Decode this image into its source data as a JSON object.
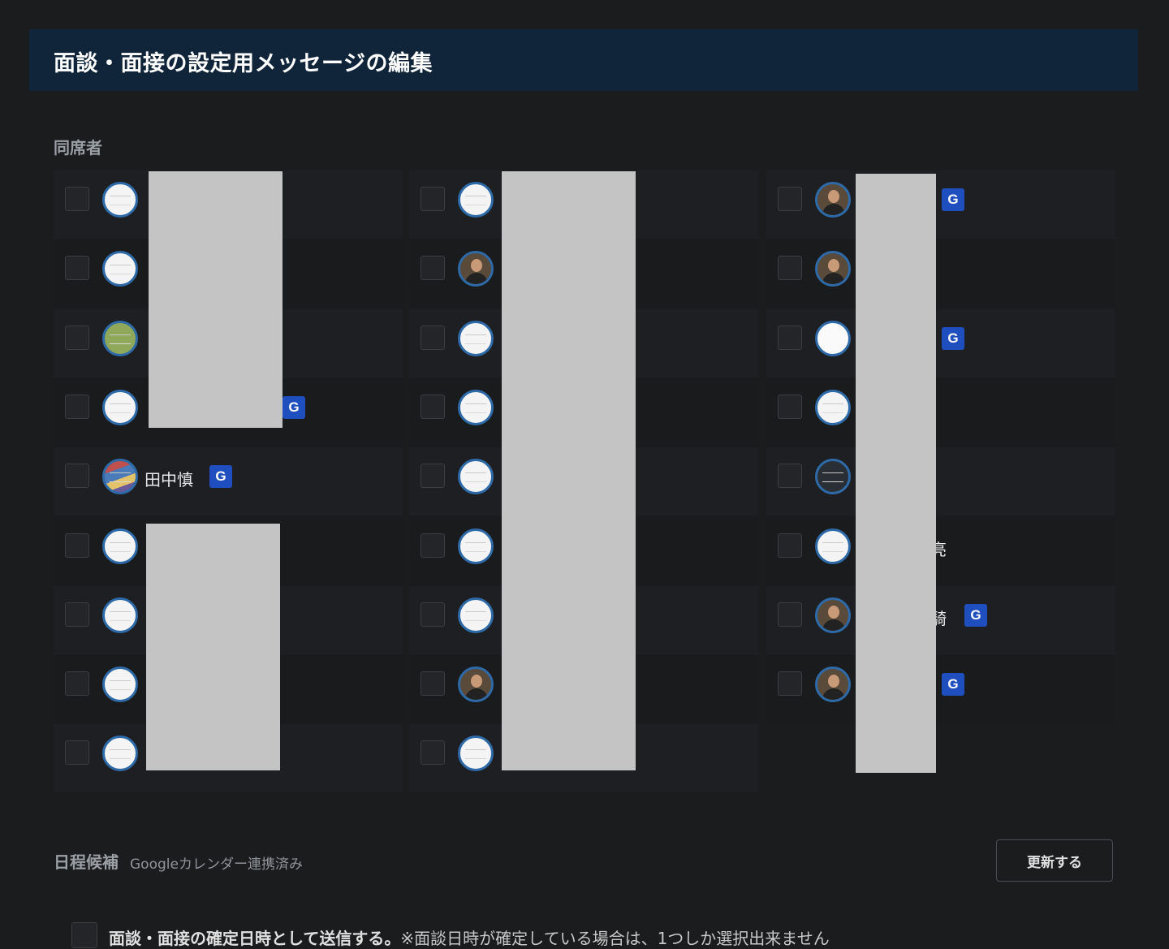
{
  "header": {
    "title": "面談・面接の設定用メッセージの編集"
  },
  "attendees_section": {
    "label": "同席者",
    "columns": [
      [
        {
          "name": "",
          "avatar": "logo",
          "google": false
        },
        {
          "name": "",
          "avatar": "logo",
          "google": false
        },
        {
          "name": "",
          "avatar": "green",
          "google": false
        },
        {
          "name": "",
          "avatar": "logo",
          "google": true
        },
        {
          "name": "田中慎",
          "avatar": "striped",
          "google": true
        },
        {
          "name": "",
          "avatar": "logo",
          "google": false
        },
        {
          "name": "",
          "avatar": "logo",
          "google": false
        },
        {
          "name": "",
          "avatar": "logo",
          "google": false
        },
        {
          "name": "",
          "avatar": "logo",
          "google": false
        }
      ],
      [
        {
          "name": "",
          "avatar": "logo",
          "google": false
        },
        {
          "name": "",
          "avatar": "photo",
          "google": false
        },
        {
          "name": "",
          "avatar": "logo",
          "google": false
        },
        {
          "name": "",
          "avatar": "logo",
          "google": false
        },
        {
          "name": "",
          "avatar": "logo",
          "google": false
        },
        {
          "name": "",
          "avatar": "logo",
          "google": false
        },
        {
          "name": "",
          "avatar": "logo",
          "google": false
        },
        {
          "name": "",
          "avatar": "photo",
          "google": false
        },
        {
          "name": "",
          "avatar": "logo",
          "google": false
        }
      ],
      [
        {
          "name": "",
          "avatar": "photo",
          "google": true
        },
        {
          "name": "",
          "avatar": "photo",
          "google": false
        },
        {
          "name": "",
          "avatar": "white",
          "google": true
        },
        {
          "name": "",
          "avatar": "logo",
          "google": false
        },
        {
          "name": "",
          "avatar": "dark",
          "google": false
        },
        {
          "name": "亮",
          "avatar": "logo",
          "google": false
        },
        {
          "name": "騎",
          "avatar": "photo",
          "google": true
        },
        {
          "name": "",
          "avatar": "photo",
          "google": true
        }
      ]
    ],
    "google_badge_label": "G"
  },
  "schedule": {
    "label": "日程候補",
    "sub": "Googleカレンダー連携済み",
    "update_button": "更新する"
  },
  "confirm": {
    "bold": "面談・面接の確定日時として送信する。",
    "note": "※面談日時が確定している場合は、1つしか選択出来ません"
  }
}
